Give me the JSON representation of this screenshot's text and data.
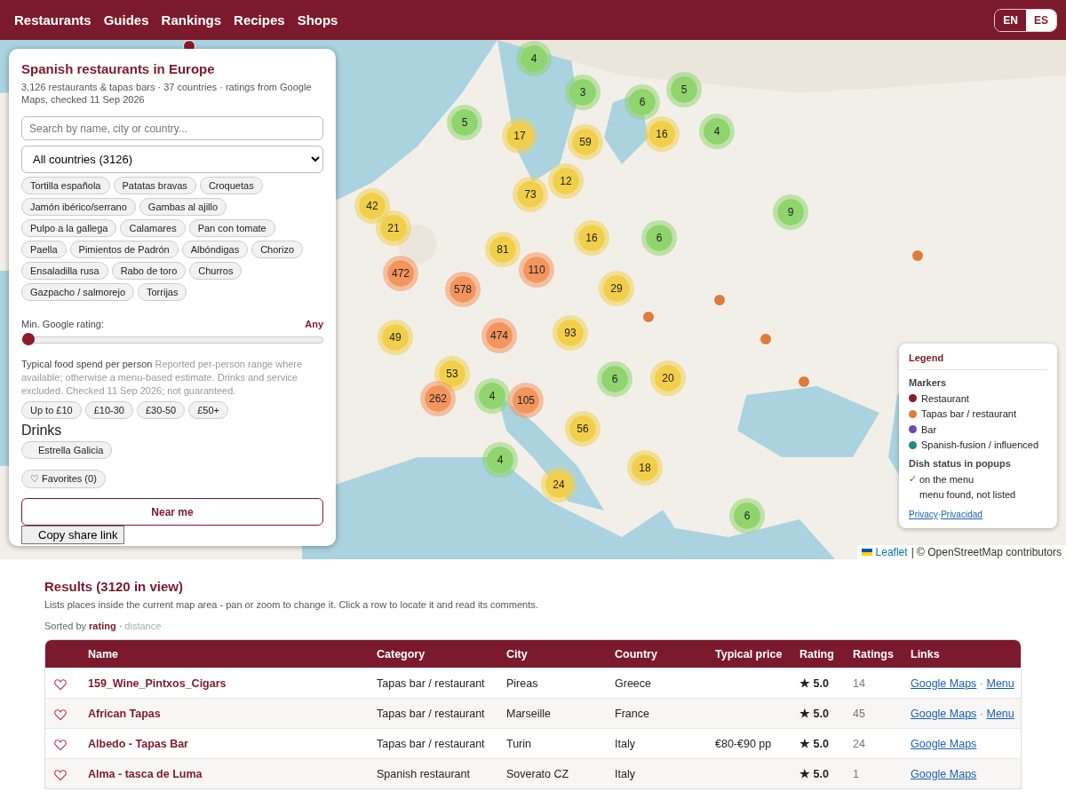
{
  "nav": {
    "items": [
      {
        "label": "Restaurants"
      },
      {
        "label": "Guides"
      },
      {
        "label": "Rankings"
      },
      {
        "label": "Recipes"
      },
      {
        "label": "Shops"
      }
    ],
    "languages": [
      {
        "label": "EN",
        "selected": true
      },
      {
        "label": "ES",
        "selected": false
      }
    ]
  },
  "map": {
    "clusters": [
      {
        "count": "4",
        "color": "#8fd46c"
      },
      {
        "count": "3",
        "color": "#8fd46c"
      },
      {
        "count": "6",
        "color": "#8fd46c"
      },
      {
        "count": "5",
        "color": "#8fd46c"
      },
      {
        "count": "5",
        "color": "#8fd46c"
      },
      {
        "count": "17",
        "color": "#f2cf4a"
      },
      {
        "count": "59",
        "color": "#f2cf4a"
      },
      {
        "count": "16",
        "color": "#f2cf4a"
      },
      {
        "count": "4",
        "color": "#8fd46c"
      },
      {
        "count": "73",
        "color": "#f2cf4a"
      },
      {
        "count": "12",
        "color": "#f2cf4a"
      },
      {
        "count": "9",
        "color": "#8fd46c"
      },
      {
        "count": "42",
        "color": "#f2cf4a"
      },
      {
        "count": "21",
        "color": "#f2cf4a"
      },
      {
        "count": "16",
        "color": "#f2cf4a"
      },
      {
        "count": "6",
        "color": "#8fd46c"
      },
      {
        "count": "81",
        "color": "#f2cf4a"
      },
      {
        "count": "110",
        "color": "#f4955e"
      },
      {
        "count": "472",
        "color": "#f4955e"
      },
      {
        "count": "578",
        "color": "#f4955e"
      },
      {
        "count": "29",
        "color": "#f2cf4a"
      },
      {
        "count": "49",
        "color": "#f2cf4a"
      },
      {
        "count": "474",
        "color": "#f4955e"
      },
      {
        "count": "93",
        "color": "#f2cf4a"
      },
      {
        "count": "53",
        "color": "#f2cf4a"
      },
      {
        "count": "4",
        "color": "#8fd46c"
      },
      {
        "count": "6",
        "color": "#8fd46c"
      },
      {
        "count": "20",
        "color": "#f2cf4a"
      },
      {
        "count": "262",
        "color": "#f4955e"
      },
      {
        "count": "105",
        "color": "#f4955e"
      },
      {
        "count": "56",
        "color": "#f2cf4a"
      },
      {
        "count": "4",
        "color": "#8fd46c"
      },
      {
        "count": "18",
        "color": "#f2cf4a"
      },
      {
        "count": "24",
        "color": "#f2cf4a"
      },
      {
        "count": "6",
        "color": "#8fd46c"
      }
    ],
    "points": [
      {
        "color": "#e07b39"
      },
      {
        "color": "#e07b39"
      },
      {
        "color": "#e07b39"
      },
      {
        "color": "#e07b39"
      },
      {
        "color": "#e07b39"
      },
      {
        "color": "#8b1a2b"
      }
    ],
    "attribution": {
      "link": "Leaflet",
      "text": "| © OpenStreetMap contributors"
    }
  },
  "panel": {
    "title": "Spanish restaurants in Europe",
    "subtitle": "3,126 restaurants & tapas bars · 37 countries · ratings from Google Maps, checked 11 Sep 2026",
    "search": {
      "placeholder": "Search by name, city or country..."
    },
    "country_select": {
      "value": "All countries (3126)"
    },
    "dishes": [
      {
        "label": "Tortilla española",
        "selected": false
      },
      {
        "label": "Patatas bravas",
        "selected": false
      },
      {
        "label": "Croquetas",
        "selected": false
      },
      {
        "label": "Jamón ibérico/serrano",
        "selected": false
      },
      {
        "label": "Gambas al ajillo",
        "selected": false
      },
      {
        "label": "Pulpo a la gallega",
        "selected": false
      },
      {
        "label": "Calamares",
        "selected": false
      },
      {
        "label": "Pan con tomate",
        "selected": false
      },
      {
        "label": "Paella",
        "selected": false
      },
      {
        "label": "Pimientos de Padrón",
        "selected": false
      },
      {
        "label": "Albóndigas",
        "selected": false
      },
      {
        "label": "Chorizo",
        "selected": false
      },
      {
        "label": "Ensaladilla rusa",
        "selected": false
      },
      {
        "label": "Rabo de toro",
        "selected": false
      },
      {
        "label": "Churros",
        "selected": false
      },
      {
        "label": "Gazpacho / salmorejo",
        "selected": false
      },
      {
        "label": "Torrijas",
        "selected": false
      }
    ],
    "rating": {
      "label": "Min. Google rating:",
      "value": "Any",
      "level": 0
    },
    "spend": {
      "title": "Typical food spend per person",
      "note": "Reported per-person range where available; otherwise a menu-based estimate. Drinks and service excluded. Checked 11 Sep 2026; not guaranteed.",
      "options": [
        {
          "label": "Up to £10",
          "selected": false
        },
        {
          "label": "£10-30",
          "selected": false
        },
        {
          "label": "£30-50",
          "selected": false
        },
        {
          "label": "£50+",
          "selected": false
        }
      ]
    },
    "drinks": {
      "title": "Drinks",
      "options": [
        {
          "label": "Estrella Galicia",
          "selected": false
        }
      ]
    },
    "favorites": "♡ Favorites (0)",
    "near_me": "Near me",
    "share": "Copy share link"
  },
  "legend": {
    "title": "Legend",
    "markers_title": "Markers",
    "markers": [
      {
        "label": "Restaurant",
        "color": "#8b1a2b"
      },
      {
        "label": "Tapas bar / restaurant",
        "color": "#e07b39"
      },
      {
        "label": "Bar",
        "color": "#6a4bb0"
      },
      {
        "label": "Spanish-fusion / influenced",
        "color": "#1f8a85"
      }
    ],
    "dish_title": "Dish status in popups",
    "dish_status": [
      {
        "mark": "✓",
        "label": "on the menu"
      },
      {
        "label": "menu found, not listed"
      }
    ],
    "links": [
      "Privacy",
      "Privacidad"
    ],
    "separator": "·"
  },
  "results": {
    "title": "Results (3120 in view)",
    "description": "Lists places inside the current map area - pan or zoom to change it. Click a row to locate it and read its comments.",
    "sort": {
      "label": "Sorted by",
      "separator": "·",
      "options": [
        {
          "label": "rating",
          "selected": true
        },
        {
          "label": "distance",
          "selected": false
        }
      ]
    },
    "table": {
      "columns": [
        "Name",
        "Category",
        "City",
        "Country",
        "Typical price",
        "Rating",
        "Ratings",
        "Links"
      ],
      "link_separator": "·",
      "rows": [
        {
          "favorite": false,
          "name": "159_Wine_Pintxos_Cigars",
          "category": "Tapas bar / restaurant",
          "city": "Pireas",
          "country": "Greece",
          "price": "",
          "rating": "★ 5.0",
          "ratings": "14",
          "links": [
            "Google Maps",
            "Menu"
          ]
        },
        {
          "favorite": false,
          "name": "African Tapas",
          "category": "Tapas bar / restaurant",
          "city": "Marseille",
          "country": "France",
          "price": "",
          "rating": "★ 5.0",
          "ratings": "45",
          "links": [
            "Google Maps",
            "Menu"
          ]
        },
        {
          "favorite": false,
          "name": "Albedo - Tapas Bar",
          "category": "Tapas bar / restaurant",
          "city": "Turin",
          "country": "Italy",
          "price": "€80-€90 pp",
          "rating": "★ 5.0",
          "ratings": "24",
          "links": [
            "Google Maps"
          ]
        },
        {
          "favorite": false,
          "name": "Alma - tasca de Luma",
          "category": "Spanish restaurant",
          "city": "Soverato CZ",
          "country": "Italy",
          "price": "",
          "rating": "★ 5.0",
          "ratings": "1",
          "links": [
            "Google Maps"
          ]
        }
      ]
    }
  }
}
